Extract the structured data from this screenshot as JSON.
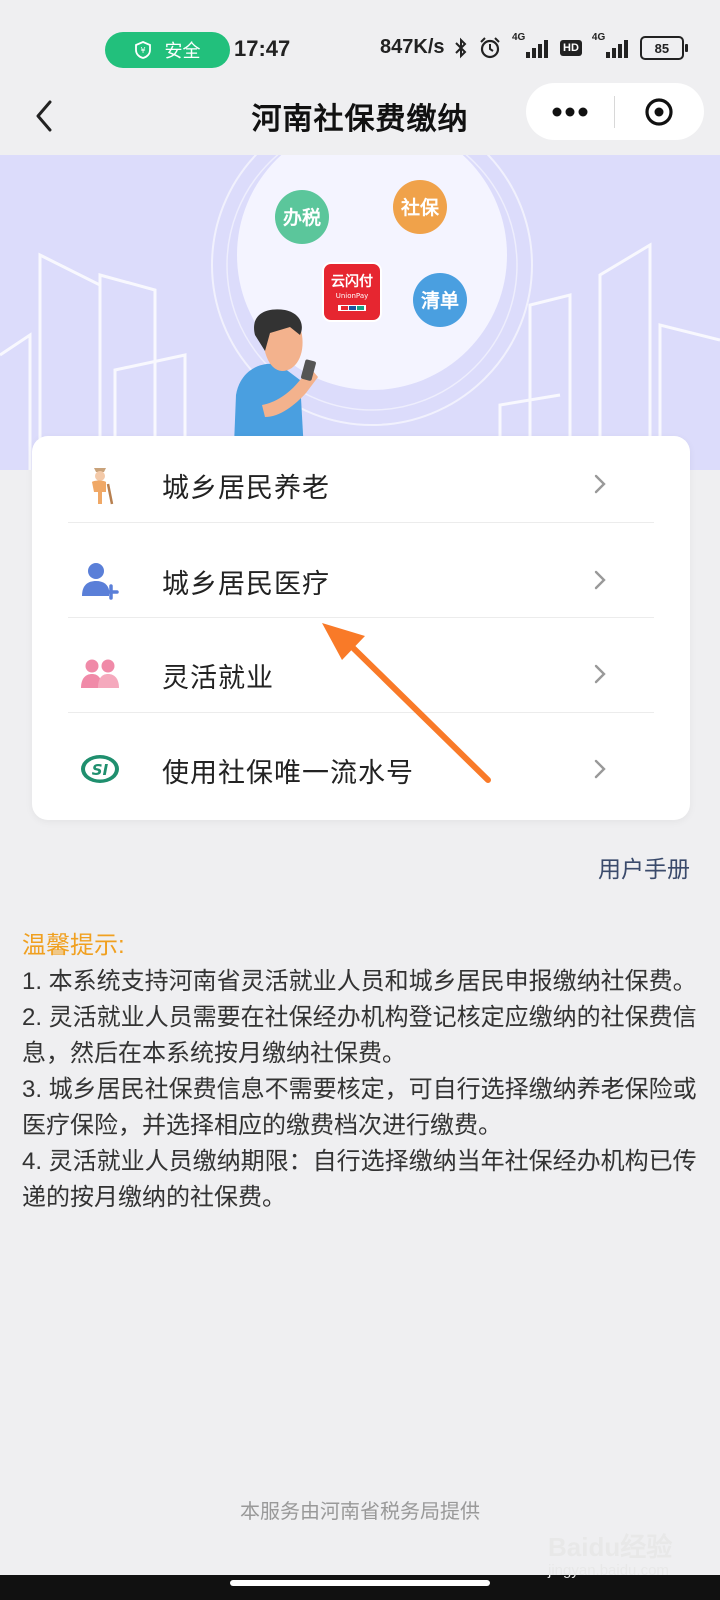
{
  "status_bar": {
    "safety_label": "安全",
    "time": "17:47",
    "net_speed": "847K/s",
    "network_1": "4G",
    "hd": "HD",
    "network_2": "4G",
    "battery": "85"
  },
  "nav": {
    "title": "河南社保费缴纳"
  },
  "banner": {
    "bubbles": [
      "办税",
      "社保",
      "清单"
    ],
    "pay_logo_text": "云闪付",
    "pay_logo_sub": "UnionPay"
  },
  "menu": {
    "items": [
      {
        "label": "城乡居民养老",
        "icon": "elderly-person-icon"
      },
      {
        "label": "城乡居民医疗",
        "icon": "add-user-icon"
      },
      {
        "label": "灵活就业",
        "icon": "group-people-icon"
      },
      {
        "label": "使用社保唯一流水号",
        "icon": "si-logo-icon"
      }
    ]
  },
  "manual_link": "用户手册",
  "tips": {
    "title": "温馨提示:",
    "lines": [
      "1. 本系统支持河南省灵活就业人员和城乡居民申报缴纳社保费。",
      "2. 灵活就业人员需要在社保经办机构登记核定应缴纳的社保费信息，然后在本系统按月缴纳社保费。",
      "3. 城乡居民社保费信息不需要核定，可自行选择缴纳养老保险或医疗保险，并选择相应的缴费档次进行缴费。",
      "4. 灵活就业人员缴纳期限：自行选择缴纳当年社保经办机构已传递的按月缴纳的社保费。"
    ]
  },
  "footer": "本服务由河南省税务局提供",
  "watermark": {
    "brand": "Baidu经验",
    "url": "jingyan.baidu.com"
  },
  "colors": {
    "safety_green": "#22c07c",
    "banner_bg": "#dcdcfb",
    "tips_title": "#f0a020",
    "arrow": "#f97a28"
  }
}
